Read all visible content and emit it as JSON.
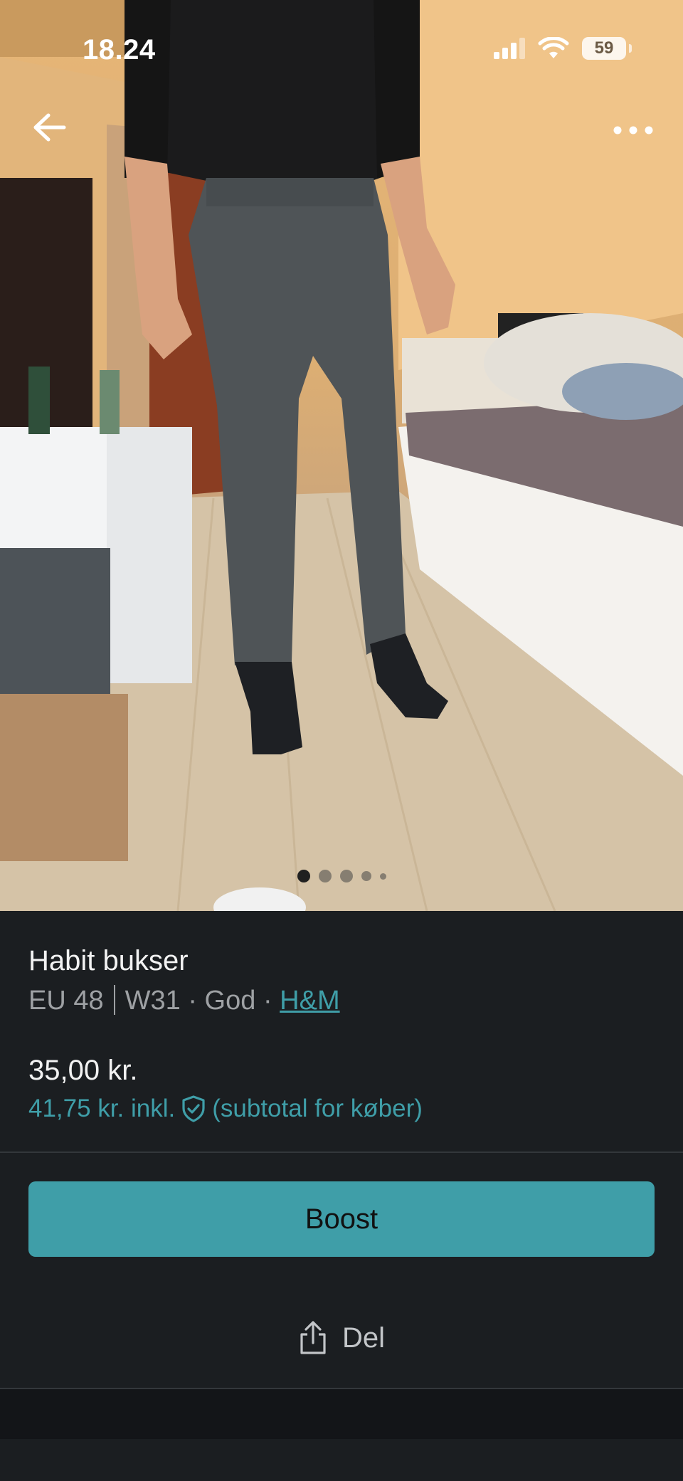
{
  "status_bar": {
    "time": "18.24",
    "battery": "59",
    "icons": [
      "signal-icon",
      "wifi-icon",
      "battery-icon"
    ]
  },
  "photo": {
    "pager": {
      "total": 5,
      "active": 1
    }
  },
  "listing": {
    "title": "Habit bukser",
    "size_eu": "EU 48",
    "size_w": "W31",
    "condition": "God",
    "brand": "H&M",
    "dot": "·",
    "price": "35,00 kr.",
    "price_incl": "41,75 kr. inkl.",
    "price_incl_note": "(subtotal for køber)"
  },
  "actions": {
    "boost_label": "Boost",
    "share_label": "Del"
  },
  "colors": {
    "accent": "#3f9ea8",
    "background": "#1b1e21"
  }
}
